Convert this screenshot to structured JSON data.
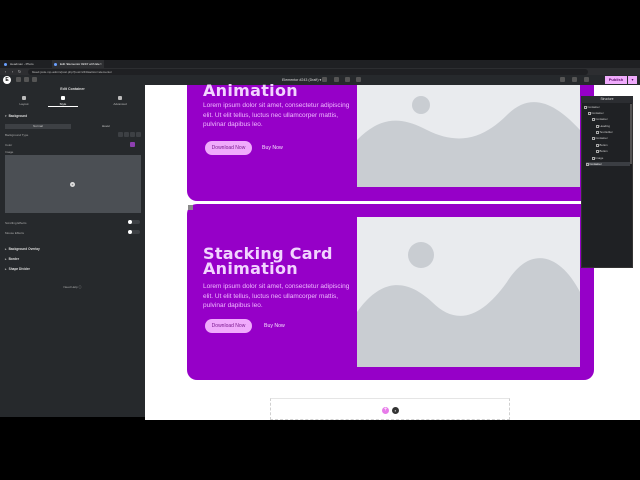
{
  "browser": {
    "tabs": [
      {
        "label": "Headman - Photo"
      },
      {
        "label": "Edit 'Elementor #243' with Ele"
      }
    ],
    "url": "bleed.jcole.mp-admin/post.php?post=243&action=elementor"
  },
  "editor": {
    "logo": "E",
    "document_title": "Elementor #243 (Draft)",
    "publish_label": "Publish"
  },
  "panel": {
    "title": "Edit Container",
    "tabs": [
      {
        "label": "Layout"
      },
      {
        "label": "Style"
      },
      {
        "label": "Advanced"
      }
    ],
    "background": {
      "section_label": "Background",
      "states": [
        "Normal",
        "Hover"
      ],
      "background_type_label": "Background Type",
      "color_label": "Color",
      "image_label": "Image",
      "scrolling_effects_label": "Scrolling Effects",
      "mouse_effects_label": "Mouse Effects"
    },
    "sections": [
      {
        "label": "Background Overlay"
      },
      {
        "label": "Border"
      },
      {
        "label": "Shape Divider"
      }
    ],
    "need_help": "Need Help"
  },
  "canvas": {
    "card_top": {
      "heading": "Animation",
      "paragraph": "Lorem ipsum dolor sit amet, consectetur adipiscing elit. Ut elit tellus, luctus nec ullamcorper mattis, pulvinar dapibus leo.",
      "primary_button": "Download Now",
      "secondary_button": "Buy Now"
    },
    "card_main": {
      "heading_line1": "Stacking Card",
      "heading_line2": "Animation",
      "paragraph": "Lorem ipsum dolor sit amet, consectetur adipiscing elit. Ut elit tellus, luctus nec ullamcorper mattis, pulvinar dapibus leo.",
      "primary_button": "Download Now",
      "secondary_button": "Buy Now"
    },
    "add_icon": "+",
    "folder_icon": "folder-icon"
  },
  "navigator": {
    "title": "Structure",
    "items": [
      {
        "label": "Container"
      },
      {
        "label": "Container"
      },
      {
        "label": "Container"
      },
      {
        "label": "Heading"
      },
      {
        "label": "Text Editor"
      },
      {
        "label": "Container"
      },
      {
        "label": "Button"
      },
      {
        "label": "Button"
      },
      {
        "label": "Image"
      },
      {
        "label": "Container"
      }
    ]
  },
  "colors": {
    "card_purple": "#9600c8",
    "heading_pink": "#f2d4ff",
    "button_pink": "#f0abfc",
    "panel_dark": "#26292c"
  }
}
